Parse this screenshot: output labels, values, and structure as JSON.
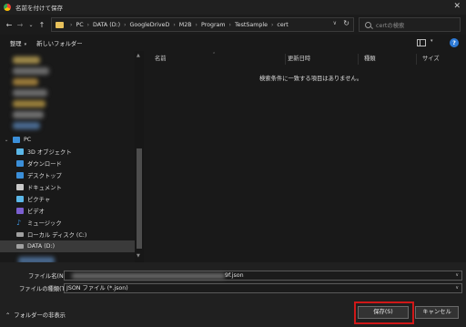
{
  "window": {
    "title": "名前を付けて保存",
    "close_icon": "close-icon"
  },
  "nav": {
    "back": "←",
    "forward": "→",
    "recent": "⌄",
    "up": "↑",
    "breadcrumbs": [
      "PC",
      "DATA (D:)",
      "GoogleDriveD",
      "M2B",
      "Program",
      "TestSample",
      "cert"
    ],
    "search_placeholder": "certの検索"
  },
  "toolbar": {
    "organize": "整理",
    "new_folder": "新しいフォルダー",
    "help": "?"
  },
  "sidebar": {
    "items": [
      {
        "label": "PC",
        "icon": "computer-icon",
        "color": "#3b8fd9"
      },
      {
        "label": "3D オブジェクト",
        "icon": "cube-icon",
        "color": "#5bb7e8"
      },
      {
        "label": "ダウンロード",
        "icon": "download-icon",
        "color": "#3b8fd9"
      },
      {
        "label": "デスクトップ",
        "icon": "desktop-icon",
        "color": "#3b8fd9"
      },
      {
        "label": "ドキュメント",
        "icon": "document-icon",
        "color": "#c9c9c9"
      },
      {
        "label": "ピクチャ",
        "icon": "picture-icon",
        "color": "#5bb7e8"
      },
      {
        "label": "ビデオ",
        "icon": "video-icon",
        "color": "#7b5fd0"
      },
      {
        "label": "ミュージック",
        "icon": "music-icon",
        "color": "#3b8fd9"
      },
      {
        "label": "ローカル ディスク (C:)",
        "icon": "drive-icon",
        "color": "#a0a0a0"
      },
      {
        "label": "DATA (D:)",
        "icon": "drive-icon",
        "color": "#a0a0a0"
      }
    ]
  },
  "filelist": {
    "columns": [
      "名前",
      "更新日時",
      "種類",
      "サイズ"
    ],
    "empty_message": "検索条件に一致する項目はありません。"
  },
  "form": {
    "filename_label": "ファイル名(N):",
    "filename_value_tail": "9f.json",
    "filetype_label": "ファイルの種類(T):",
    "filetype_value": "JSON ファイル (*.json)"
  },
  "footer": {
    "hide_folders": "フォルダーの非表示",
    "save": "保存(S)",
    "cancel": "キャンセル"
  },
  "colors": {
    "accent": "#2d7ad6",
    "highlight": "#d01818"
  }
}
